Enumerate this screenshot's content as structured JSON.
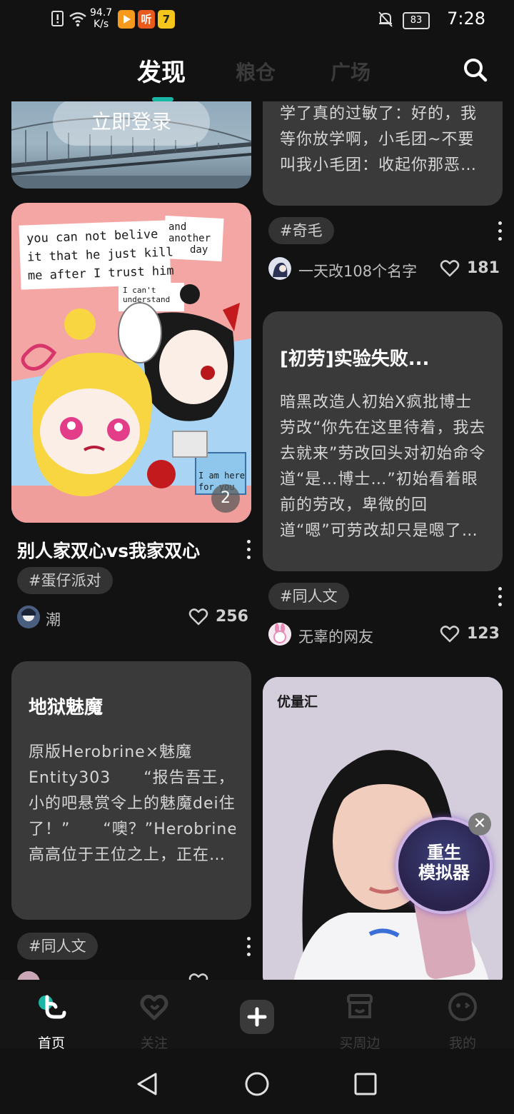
{
  "status_bar": {
    "net_speed_value": "94.7",
    "net_speed_unit": "K/s",
    "battery": "83",
    "time": "7:28",
    "app_icon_1_text": "",
    "app_icon_2_text": "听",
    "app_icon_3_text": "7"
  },
  "header": {
    "tabs": [
      {
        "label": "发现",
        "active": true
      },
      {
        "label": "粮仓",
        "active": false
      },
      {
        "label": "广场",
        "active": false
      }
    ]
  },
  "left_column": {
    "login_banner": {
      "button_label": "立即登录"
    },
    "post1": {
      "title": "别人家双心vs我家双心",
      "tag": "#蛋仔派对",
      "image_count_badge": "2",
      "image_text": {
        "line1": "you can not belive",
        "line2": "it that he just kill",
        "line3": "me after I trust him",
        "bubble_right_1": "and",
        "bubble_right_2": "another",
        "bubble_right_3": "day",
        "small_1": "I can't",
        "small_2": "understand",
        "bottom_1": "I am here",
        "bottom_2": "for you"
      },
      "author": "潮",
      "likes": "256"
    },
    "post2": {
      "title": "地狱魅魔",
      "body": "原版Herobrine×魅魔Entity303　　“报告吾王，小的吧悬赏令上的魅魔dei住了！”　　“噢？”Herobrine高高位于王位之上，正在…",
      "tag": "#同人文"
    }
  },
  "right_column": {
    "post0": {
      "body": "学了真的过敏了：好的，我等你放学啊，小毛团~不要叫我小毛团：收起你那恶…",
      "tag": "#奇毛",
      "author": "一天改108个名字",
      "likes": "181"
    },
    "post1": {
      "title": "[初劳]实验失败...",
      "body": "暗黑改造人初始X疯批博士劳改“你先在这里待着，我去去就来”劳改回头对初始命令道“是…博士…”初始看着眼前的劳改，卑微的回道“嗯”可劳改却只是嗯了…",
      "tag": "#同人文",
      "author": "无辜的网友",
      "likes": "123"
    },
    "ad": {
      "label": "优量汇",
      "badge_line1": "重生",
      "badge_line2": "模拟器"
    }
  },
  "bottom_nav": {
    "items": [
      {
        "label": "首页",
        "icon": "home-icon",
        "active": true
      },
      {
        "label": "关注",
        "icon": "heart-follow-icon",
        "active": false
      },
      {
        "label": "",
        "icon": "plus-icon",
        "active": false
      },
      {
        "label": "买周边",
        "icon": "shop-icon",
        "active": false
      },
      {
        "label": "我的",
        "icon": "profile-icon",
        "active": false
      }
    ]
  },
  "colors": {
    "background": "#121212",
    "accent": "#19b5a5",
    "card": "#3a3a3a"
  }
}
